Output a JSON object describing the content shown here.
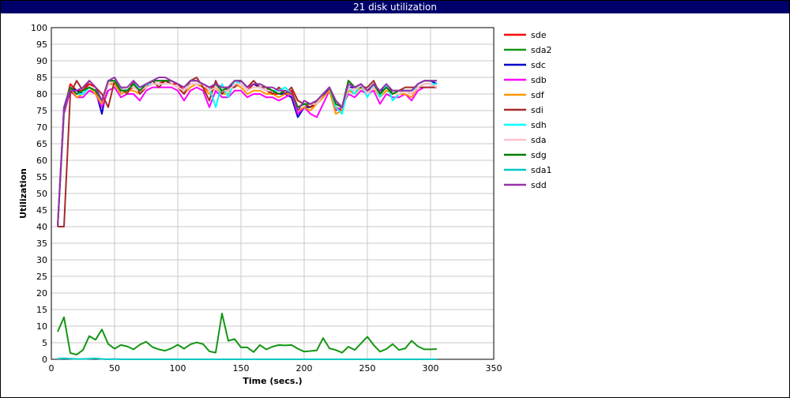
{
  "window": {
    "title": "21 disk utilization"
  },
  "chart_data": {
    "type": "line",
    "title": "21 disk utilization",
    "xlabel": "Time (secs.)",
    "ylabel": "Utilization",
    "xlim": [
      0,
      350
    ],
    "ylim": [
      0,
      100
    ],
    "xticks": [
      0,
      50,
      100,
      150,
      200,
      250,
      300,
      350
    ],
    "yticks": [
      0,
      5,
      10,
      15,
      20,
      25,
      30,
      35,
      40,
      45,
      50,
      55,
      60,
      65,
      70,
      75,
      80,
      85,
      90,
      95,
      100
    ],
    "grid": true,
    "legend_position": "right",
    "x": [
      5,
      10,
      15,
      20,
      25,
      30,
      35,
      40,
      45,
      50,
      55,
      60,
      65,
      70,
      75,
      80,
      85,
      90,
      95,
      100,
      105,
      110,
      115,
      120,
      125,
      130,
      135,
      140,
      145,
      150,
      155,
      160,
      165,
      170,
      175,
      180,
      185,
      190,
      195,
      200,
      205,
      210,
      215,
      220,
      225,
      230,
      235,
      240,
      245,
      250,
      255,
      260,
      265,
      270,
      275,
      280,
      285,
      290,
      295,
      300,
      305
    ],
    "series": [
      {
        "name": "sde",
        "color": "#ff0000",
        "values": [
          40,
          75,
          83,
          81,
          81,
          83,
          82,
          78,
          83,
          83,
          81,
          81,
          82,
          81,
          82,
          83,
          83,
          84,
          83,
          83,
          81,
          83,
          83,
          82,
          81,
          83,
          82,
          82,
          83,
          83,
          81,
          83,
          82,
          81,
          80,
          80,
          80,
          81,
          76,
          77,
          76,
          77,
          79,
          82,
          76,
          75,
          82,
          81,
          83,
          81,
          82,
          80,
          82,
          80,
          81,
          81,
          80,
          82,
          83,
          83,
          82
        ]
      },
      {
        "name": "sda2",
        "color": "#149614",
        "values": [
          8.3,
          12.7,
          1.9,
          1.4,
          2.8,
          7,
          5.9,
          9,
          4.6,
          3.2,
          4.3,
          3.9,
          3,
          4.4,
          5.3,
          3.7,
          3,
          2.6,
          3.3,
          4.4,
          3.2,
          4.5,
          5.1,
          4.6,
          2.4,
          2,
          13.8,
          5.6,
          6.1,
          3.6,
          3.6,
          2.2,
          4.3,
          3,
          3.8,
          4.3,
          4.2,
          4.3,
          3.2,
          2.3,
          2.5,
          2.7,
          6.4,
          3.3,
          2.8,
          2,
          3.8,
          2.8,
          4.8,
          6.8,
          4.3,
          2.3,
          3.1,
          4.6,
          2.8,
          3.3,
          5.6,
          3.9,
          3,
          3,
          3.1
        ]
      },
      {
        "name": "sdc",
        "color": "#0000cd",
        "values": [
          40,
          76,
          82,
          81,
          80,
          82,
          81,
          74,
          84,
          84,
          80,
          81,
          83,
          81,
          83,
          84,
          84,
          84,
          84,
          83,
          82,
          84,
          84,
          83,
          82,
          83,
          81,
          81,
          84,
          84,
          82,
          83,
          82,
          81,
          81,
          80,
          80,
          79,
          73,
          76,
          76,
          78,
          79,
          82,
          77,
          76,
          82,
          82,
          83,
          81,
          83,
          80,
          83,
          80,
          80,
          81,
          81,
          83,
          84,
          84,
          83
        ]
      },
      {
        "name": "sdb",
        "color": "#ff00ff",
        "values": [
          40,
          74,
          81,
          79,
          79,
          81,
          80,
          76,
          81,
          82,
          79,
          80,
          80,
          78,
          81,
          82,
          82,
          82,
          82,
          81,
          78,
          81,
          82,
          81,
          76,
          81,
          79,
          79,
          81,
          81,
          79,
          80,
          80,
          79,
          79,
          78,
          79,
          80,
          74,
          76,
          74,
          73,
          77,
          81,
          75,
          76,
          80,
          79,
          81,
          80,
          81,
          77,
          80,
          79,
          79,
          80,
          78,
          81,
          82,
          82,
          82
        ]
      },
      {
        "name": "sdf",
        "color": "#ff9600",
        "values": [
          40,
          75,
          82,
          79,
          80,
          82,
          80,
          77,
          83,
          83,
          80,
          81,
          81,
          80,
          82,
          83,
          83,
          83,
          83,
          82,
          80,
          82,
          83,
          82,
          80,
          82,
          80,
          80,
          83,
          82,
          80,
          81,
          81,
          80,
          80,
          79,
          80,
          80,
          75,
          76,
          75,
          77,
          79,
          81,
          74,
          75,
          81,
          80,
          82,
          80,
          82,
          79,
          81,
          80,
          80,
          80,
          79,
          82,
          83,
          83,
          82
        ]
      },
      {
        "name": "sdi",
        "color": "#a52a2a",
        "values": [
          40,
          40,
          80,
          84,
          81,
          84,
          82,
          80,
          76,
          84,
          82,
          80,
          84,
          80,
          82,
          84,
          82,
          84,
          83,
          82,
          80,
          84,
          85,
          82,
          78,
          84,
          80,
          82,
          82,
          84,
          82,
          84,
          82,
          82,
          80,
          82,
          80,
          82,
          78,
          77,
          76,
          78,
          80,
          82,
          78,
          76,
          84,
          82,
          82,
          82,
          84,
          80,
          82,
          81,
          81,
          82,
          82,
          82,
          82,
          82,
          82
        ]
      },
      {
        "name": "sdh",
        "color": "#00ffff",
        "values": [
          40,
          75,
          82,
          80,
          80,
          82,
          81,
          78,
          84,
          84,
          82,
          81,
          83,
          82,
          83,
          83,
          83,
          83,
          83,
          82,
          81,
          83,
          83,
          83,
          82,
          76,
          83,
          79,
          84,
          83,
          81,
          82,
          82,
          81,
          81,
          81,
          82,
          80,
          76,
          77,
          77,
          77,
          80,
          82,
          76,
          74,
          82,
          80,
          83,
          79,
          83,
          79,
          83,
          78,
          80,
          81,
          81,
          82,
          83,
          83,
          83
        ]
      },
      {
        "name": "sda",
        "color": "#ffc0cb",
        "values": [
          40,
          75,
          82,
          80,
          81,
          82,
          81,
          78,
          83,
          84,
          81,
          82,
          82,
          81,
          82,
          83,
          83,
          83,
          83,
          82,
          81,
          83,
          83,
          83,
          81,
          82,
          81,
          81,
          83,
          83,
          81,
          82,
          82,
          81,
          81,
          80,
          81,
          80,
          76,
          77,
          77,
          77,
          80,
          82,
          77,
          76,
          82,
          81,
          83,
          80,
          82,
          80,
          82,
          80,
          80,
          81,
          80,
          82,
          83,
          83,
          82
        ]
      },
      {
        "name": "sdg",
        "color": "#008000",
        "values": [
          40,
          75,
          82,
          80,
          81,
          82,
          81,
          78,
          84,
          84,
          81,
          81,
          83,
          81,
          83,
          84,
          84,
          84,
          84,
          83,
          82,
          84,
          84,
          83,
          82,
          83,
          81,
          82,
          84,
          84,
          82,
          83,
          83,
          82,
          81,
          80,
          81,
          80,
          76,
          77,
          77,
          78,
          80,
          82,
          77,
          76,
          84,
          82,
          83,
          81,
          83,
          80,
          82,
          80,
          81,
          81,
          81,
          83,
          84,
          84,
          84
        ]
      },
      {
        "name": "sda1",
        "color": "#00c8c8",
        "values": [
          0.2,
          0.3,
          0.2,
          0.1,
          0.1,
          0.2,
          0.3,
          0.1,
          0,
          0.1,
          0,
          0,
          0,
          0,
          0,
          0,
          0,
          0,
          0,
          0,
          0,
          0,
          0,
          0,
          0,
          0,
          0,
          0,
          0,
          0,
          0,
          0,
          0,
          0,
          0,
          0,
          0,
          0,
          0,
          0,
          0,
          0,
          0,
          0,
          0,
          0,
          0,
          0,
          0,
          0,
          0,
          0,
          0,
          0,
          0,
          0,
          0,
          0,
          0,
          0,
          0
        ]
      },
      {
        "name": "sdd",
        "color": "#9b30ad",
        "values": [
          40,
          76,
          81,
          81,
          82,
          84,
          82,
          78,
          84,
          85,
          82,
          82,
          84,
          82,
          83,
          84,
          85,
          85,
          84,
          83,
          82,
          84,
          84,
          83,
          82,
          83,
          82,
          82,
          84,
          84,
          82,
          83,
          83,
          82,
          82,
          81,
          81,
          80,
          75,
          78,
          77,
          78,
          80,
          82,
          78,
          76,
          83,
          82,
          83,
          81,
          83,
          81,
          83,
          81,
          81,
          81,
          81,
          83,
          84,
          84,
          84
        ]
      }
    ]
  }
}
